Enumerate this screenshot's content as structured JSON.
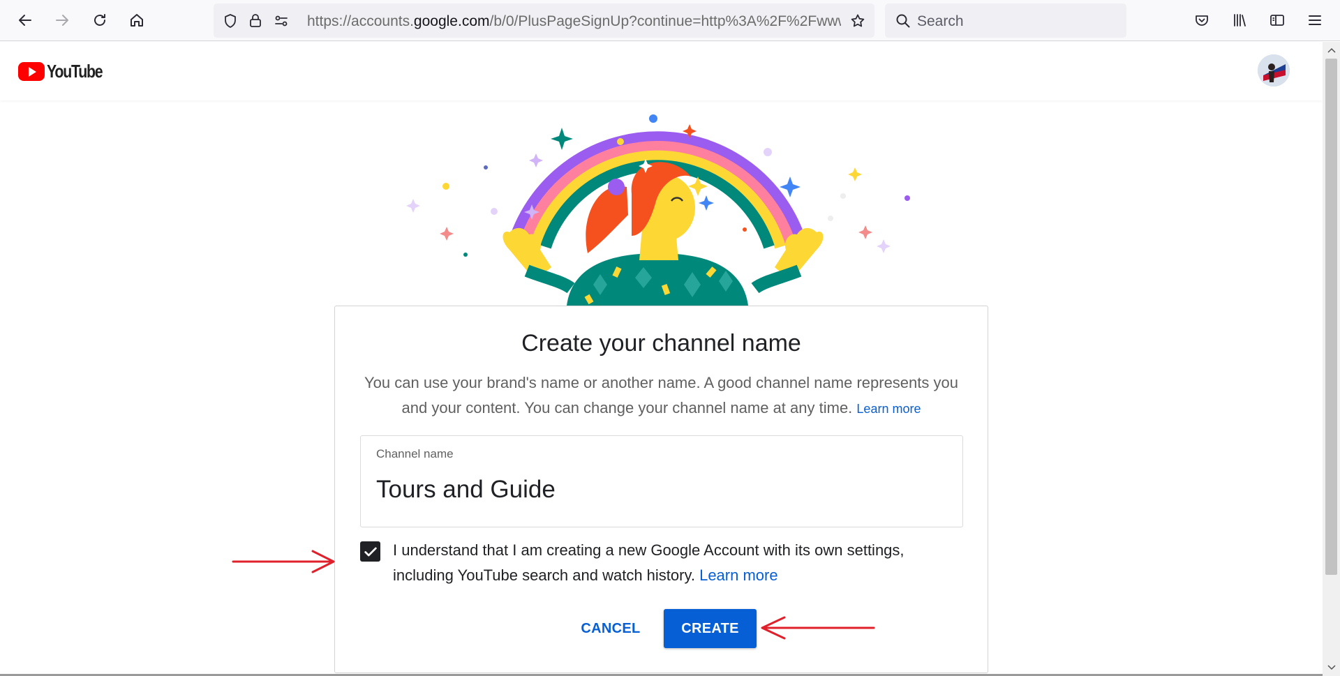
{
  "browser": {
    "url_prefix": "https://accounts.",
    "url_host": "google.com",
    "url_path": "/b/0/PlusPageSignUp?continue=http%3A%2F%2Fwww",
    "search_placeholder": "Search"
  },
  "header": {
    "logo_text": "YouTube"
  },
  "dialog": {
    "title": "Create your channel name",
    "description": "You can use your brand's name or another name. A good channel name represents you and your content. You can change your channel name at any time.",
    "description_link": "Learn more",
    "field_label": "Channel name",
    "field_value": "Tours and Guide",
    "checkbox_text": "I understand that I am creating a new Google Account with its own settings, including YouTube search and watch history.",
    "checkbox_link": "Learn more",
    "checkbox_checked": true,
    "cancel_label": "CANCEL",
    "create_label": "CREATE"
  },
  "colors": {
    "accent": "#065fd4",
    "brand_red": "#ff0000",
    "annotation_arrow": "#e0202a"
  }
}
